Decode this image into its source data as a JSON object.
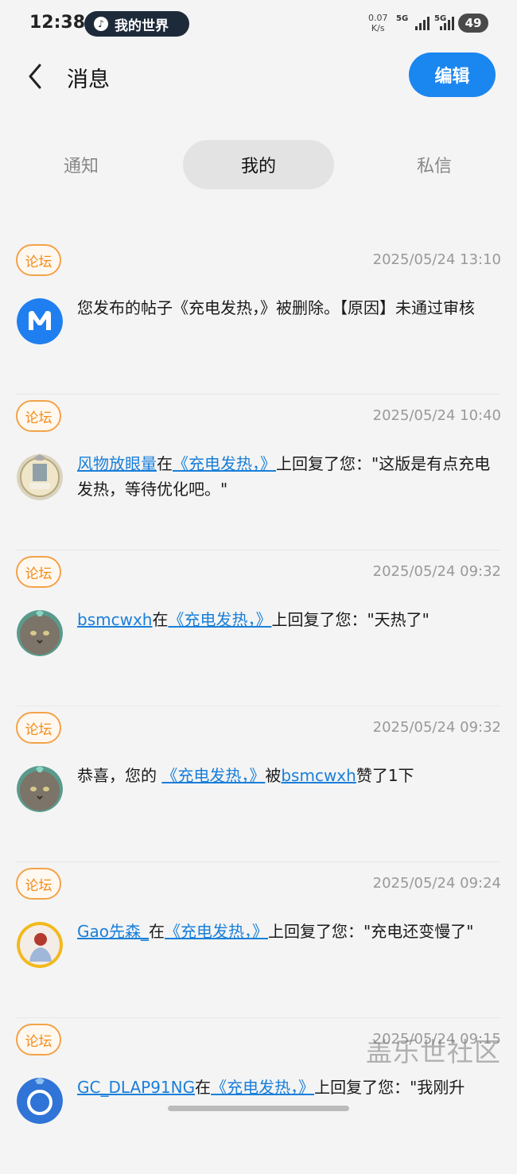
{
  "status_bar": {
    "time": "12:38",
    "music_label": "我的世界",
    "net_speed_value": "0.07",
    "net_speed_unit": "K/s",
    "sig1": "5G",
    "sig2": "5G",
    "battery": "49"
  },
  "header": {
    "title": "消息",
    "edit_label": "编辑"
  },
  "tabs": [
    {
      "label": "通知",
      "active": false
    },
    {
      "label": "我的",
      "active": true
    },
    {
      "label": "私信",
      "active": false
    }
  ],
  "messages": [
    {
      "badge": "论坛",
      "time": "2025/05/24 13:10",
      "text": "您发布的帖子《充电发热，》被删除。【原因】未通过审核"
    },
    {
      "badge": "论坛",
      "time": "2025/05/24 10:40",
      "user": "风物放眼量",
      "mid1": "在",
      "post": "《充电发热，》",
      "tail": "上回复了您：\"这版是有点充电发热，等待优化吧。\""
    },
    {
      "badge": "论坛",
      "time": "2025/05/24 09:32",
      "user": "bsmcwxh",
      "mid1": "在",
      "post": "《充电发热，》",
      "tail": "上回复了您：\"天热了\""
    },
    {
      "badge": "论坛",
      "time": "2025/05/24 09:32",
      "pre": "恭喜，您的",
      "post": "《充电发热，》",
      "mid2": "被",
      "user": "bsmcwxh",
      "tail": "赞了1下"
    },
    {
      "badge": "论坛",
      "time": "2025/05/24 09:24",
      "user": "Gao先森_",
      "mid1": "在",
      "post": "《充电发热，》",
      "tail": "上回复了您：\"充电还变慢了\""
    },
    {
      "badge": "论坛",
      "time": "2025/05/24 09:15",
      "user": "GC_DLAP91NG",
      "mid1": "在",
      "post": "《充电发热，》",
      "tail": "上回复了您：\"我刚升"
    }
  ],
  "watermark": "盖乐世社区",
  "colors": {
    "accent": "#1a86f0",
    "badge_orange": "#f28c1a",
    "link": "#1a7fd9"
  }
}
